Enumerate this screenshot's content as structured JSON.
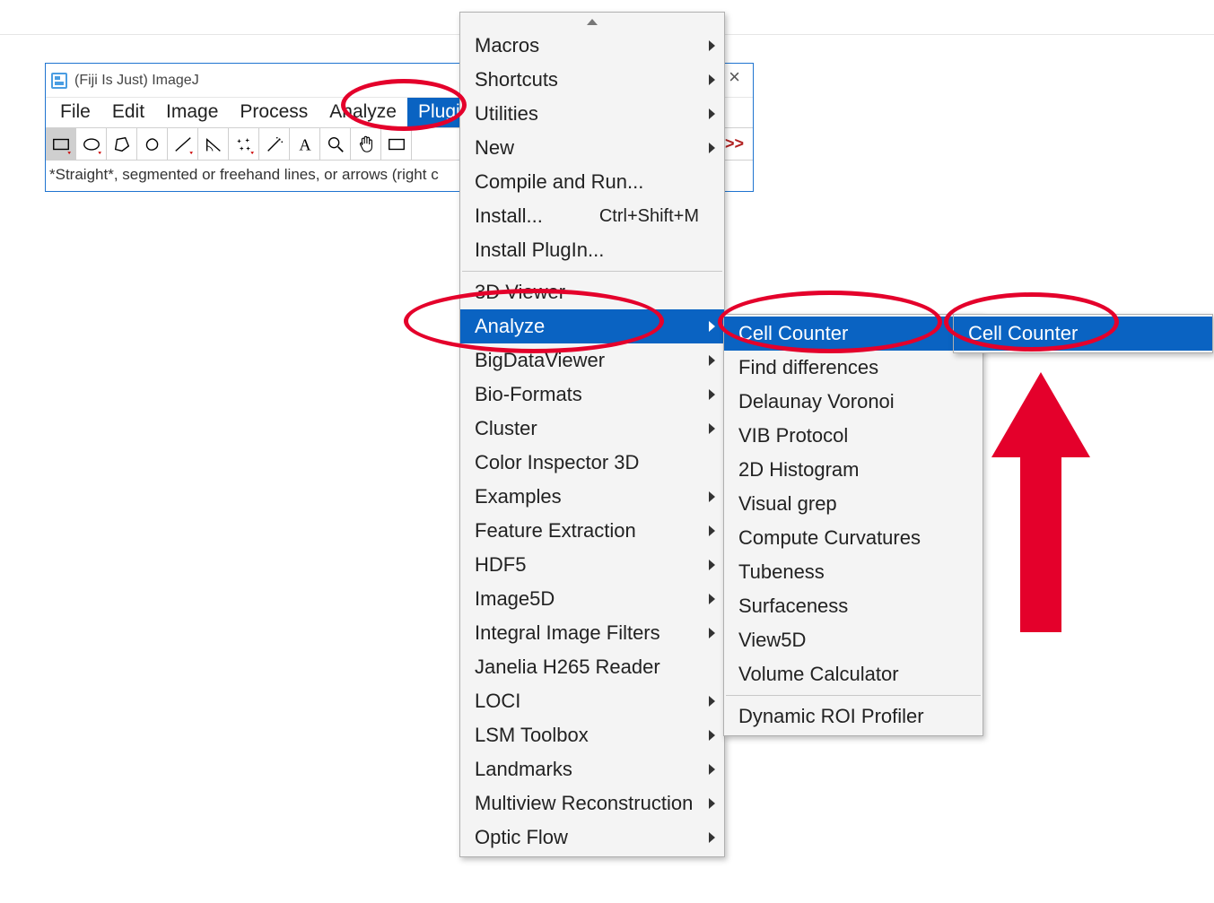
{
  "window": {
    "title": "(Fiji Is Just) ImageJ",
    "close_glyph": "×",
    "menubar": [
      "File",
      "Edit",
      "Image",
      "Process",
      "Analyze",
      "Plugins"
    ],
    "menubar_selected_index": 5,
    "toolbar": [
      {
        "name": "rect-select-tool",
        "active": true
      },
      {
        "name": "oval-select-tool"
      },
      {
        "name": "polygon-select-tool"
      },
      {
        "name": "freehand-select-tool"
      },
      {
        "name": "line-tool"
      },
      {
        "name": "angle-tool"
      },
      {
        "name": "point-tool"
      },
      {
        "name": "wand-tool"
      },
      {
        "name": "text-tool"
      },
      {
        "name": "zoom-tool"
      },
      {
        "name": "hand-tool"
      },
      {
        "name": "rect2-tool"
      }
    ],
    "toolbar_more": ">>",
    "status": "*Straight*, segmented or freehand lines, or arrows (right c"
  },
  "plugins_menu": {
    "items": [
      {
        "label": "Macros",
        "submenu": true
      },
      {
        "label": "Shortcuts",
        "submenu": true
      },
      {
        "label": "Utilities",
        "submenu": true
      },
      {
        "label": "New",
        "submenu": true
      },
      {
        "label": "Compile and Run..."
      },
      {
        "label": "Install...",
        "shortcut": "Ctrl+Shift+M"
      },
      {
        "label": "Install PlugIn..."
      },
      {
        "sep": true
      },
      {
        "label": "3D Viewer"
      },
      {
        "label": "Analyze",
        "submenu": true,
        "highlight": true
      },
      {
        "label": "BigDataViewer",
        "submenu": true
      },
      {
        "label": "Bio-Formats",
        "submenu": true
      },
      {
        "label": "Cluster",
        "submenu": true
      },
      {
        "label": "Color Inspector 3D"
      },
      {
        "label": "Examples",
        "submenu": true
      },
      {
        "label": "Feature Extraction",
        "submenu": true
      },
      {
        "label": "HDF5",
        "submenu": true
      },
      {
        "label": "Image5D",
        "submenu": true
      },
      {
        "label": "Integral Image Filters",
        "submenu": true
      },
      {
        "label": "Janelia H265 Reader"
      },
      {
        "label": "LOCI",
        "submenu": true
      },
      {
        "label": "LSM Toolbox",
        "submenu": true
      },
      {
        "label": "Landmarks",
        "submenu": true
      },
      {
        "label": "Multiview Reconstruction",
        "submenu": true
      },
      {
        "label": "Optic Flow",
        "submenu": true
      }
    ]
  },
  "analyze_menu": {
    "items": [
      {
        "label": "Cell Counter",
        "submenu": true,
        "highlight": true
      },
      {
        "label": "Find differences"
      },
      {
        "label": "Delaunay Voronoi"
      },
      {
        "label": "VIB Protocol"
      },
      {
        "label": "2D Histogram"
      },
      {
        "label": "Visual grep"
      },
      {
        "label": "Compute Curvatures"
      },
      {
        "label": "Tubeness"
      },
      {
        "label": "Surfaceness"
      },
      {
        "label": "View5D"
      },
      {
        "label": "Volume Calculator"
      },
      {
        "sep": true
      },
      {
        "label": "Dynamic ROI Profiler"
      }
    ]
  },
  "cellcounter_menu": {
    "items": [
      {
        "label": "Cell Counter",
        "highlight": true
      }
    ]
  },
  "annotations": {
    "ellipses": [
      {
        "name": "anno-plugins"
      },
      {
        "name": "anno-analyze"
      },
      {
        "name": "anno-cellcounter-sub"
      },
      {
        "name": "anno-cellcounter-final"
      }
    ],
    "arrow": {
      "name": "big-red-arrow"
    }
  },
  "colors": {
    "highlight": "#0a63c2",
    "annotation": "#e4002b",
    "window_border": "#1f74d0"
  }
}
